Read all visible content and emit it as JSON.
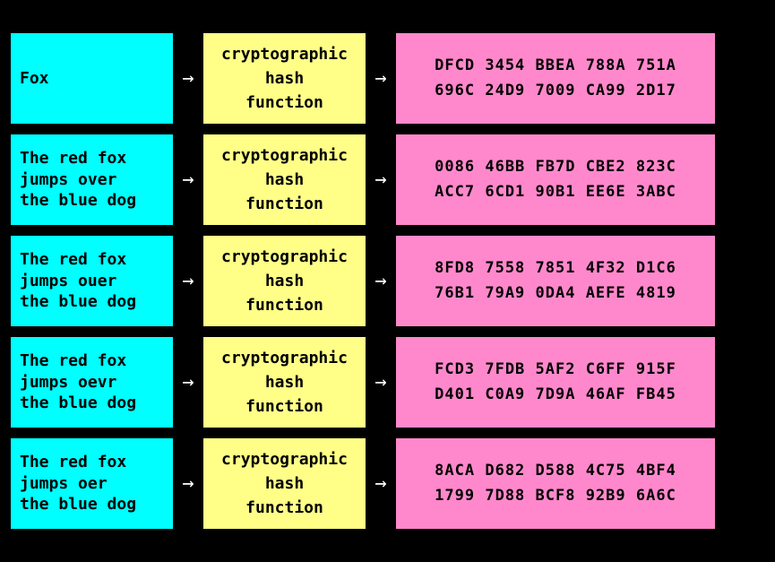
{
  "rows": [
    {
      "id": "row-1",
      "input": "Fox",
      "hash_label": "cryptographic\nhash\nfunction",
      "output_line1": "DFCD  3454  BBEA  788A  751A",
      "output_line2": "696C  24D9  7009  CA99  2D17"
    },
    {
      "id": "row-2",
      "input": "The red fox\njumps over\nthe blue dog",
      "hash_label": "cryptographic\nhash\nfunction",
      "output_line1": "0086  46BB  FB7D  CBE2  823C",
      "output_line2": "ACC7  6CD1  90B1  EE6E  3ABC"
    },
    {
      "id": "row-3",
      "input": "The red fox\njumps ouer\nthe blue dog",
      "hash_label": "cryptographic\nhash\nfunction",
      "output_line1": "8FD8  7558  7851  4F32  D1C6",
      "output_line2": "76B1  79A9  0DA4  AEFE  4819"
    },
    {
      "id": "row-4",
      "input": "The red fox\njumps oevr\nthe blue dog",
      "hash_label": "cryptographic\nhash\nfunction",
      "output_line1": "FCD3  7FDB  5AF2  C6FF  915F",
      "output_line2": "D401  C0A9  7D9A  46AF  FB45"
    },
    {
      "id": "row-5",
      "input": "The red fox\njumps oer\nthe blue dog",
      "hash_label": "cryptographic\nhash\nfunction",
      "output_line1": "8ACA  D682  D588  4C75  4BF4",
      "output_line2": "1799  7D88  BCF8  92B9  6A6C"
    }
  ],
  "arrow": "→"
}
